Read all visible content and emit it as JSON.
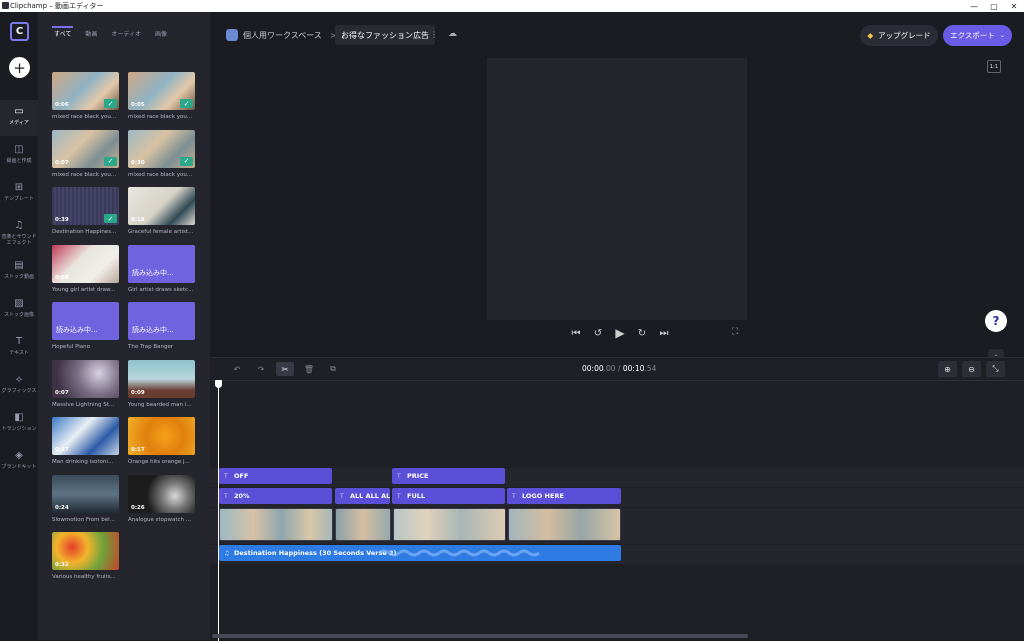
{
  "window": {
    "title": "Clipchamp – 動画エディター",
    "minimize": "—",
    "maximize": "▢",
    "close": "✕"
  },
  "colors": {
    "accent": "#6b5ce7",
    "text_clip": "#5b4fd8",
    "audio_clip": "#2d7be3",
    "check": "#2aa889"
  },
  "rail": {
    "logo": "C",
    "add": "+",
    "items": [
      {
        "icon": "folder-icon",
        "label": "メディア",
        "active": true
      },
      {
        "icon": "camera-icon",
        "label": "録画と作成"
      },
      {
        "icon": "template-icon",
        "label": "テンプレート"
      },
      {
        "icon": "music-icon",
        "label": "音楽とサウンドエフェクト"
      },
      {
        "icon": "film-icon",
        "label": "ストック動画"
      },
      {
        "icon": "image-icon",
        "label": "ストック画像"
      },
      {
        "icon": "text-icon",
        "label": "テキスト"
      },
      {
        "icon": "shapes-icon",
        "label": "グラフィックス"
      },
      {
        "icon": "transition-icon",
        "label": "トランジション"
      },
      {
        "icon": "brand-icon",
        "label": "ブランドキット"
      }
    ]
  },
  "media": {
    "tabs": [
      "すべて",
      "動画",
      "オーディオ",
      "画像"
    ],
    "active_tab": 0,
    "items": [
      {
        "duration": "0:06",
        "caption": "mixed race black you...",
        "checked": true,
        "thumb": "t-outdoor"
      },
      {
        "duration": "0:05",
        "caption": "mixed race black you...",
        "checked": true,
        "thumb": "t-outdoor"
      },
      {
        "duration": "0:07",
        "caption": "mixed race black you...",
        "checked": true,
        "thumb": "t-outdoor2"
      },
      {
        "duration": "0:30",
        "caption": "mixed race black you...",
        "checked": true,
        "thumb": "t-outdoor2"
      },
      {
        "duration": "0:39",
        "caption": "Destination Happines...",
        "checked": true,
        "thumb": "t-audio"
      },
      {
        "duration": "0:18",
        "caption": "Graceful female artist...",
        "checked": false,
        "thumb": "t-artist"
      },
      {
        "duration": "0:08",
        "caption": "Young girl artist draw...",
        "checked": false,
        "thumb": "t-draw"
      },
      {
        "loading": "読み込み中...",
        "caption": "Girl artist draws sketc...",
        "checked": false,
        "thumb": "t-loading"
      },
      {
        "loading": "読み込み中...",
        "caption": "Hopeful Piano",
        "checked": false,
        "thumb": "t-loading"
      },
      {
        "loading": "読み込み中...",
        "caption": "The Trap Banger",
        "checked": false,
        "thumb": "t-loading"
      },
      {
        "duration": "0:07",
        "caption": "Massive Lightning St...",
        "checked": false,
        "thumb": "t-storm"
      },
      {
        "duration": "0:09",
        "caption": "Young bearded man i...",
        "checked": false,
        "thumb": "t-man"
      },
      {
        "duration": "0:27",
        "caption": "Man drinking isotoni...",
        "checked": false,
        "thumb": "t-drink"
      },
      {
        "duration": "0:17",
        "caption": "Orange hits orange j...",
        "checked": false,
        "thumb": "t-orange"
      },
      {
        "duration": "0:24",
        "caption": "Slowmotion From bel...",
        "checked": false,
        "thumb": "t-gym"
      },
      {
        "duration": "0:26",
        "caption": "Analogue stopwatch ...",
        "checked": false,
        "thumb": "t-watch"
      },
      {
        "duration": "0:32",
        "caption": "Various healthy fruits...",
        "checked": false,
        "thumb": "t-fruit"
      }
    ]
  },
  "header": {
    "workspace": "個人用ワークスペース",
    "separator": ">",
    "project_name": "お得なファッション広告",
    "more": "⋮",
    "upgrade": "アップグレード",
    "export": "エクスポート"
  },
  "preview": {
    "aspect_ratio": "1:1",
    "help": "?"
  },
  "timeline": {
    "time_current": "00:00",
    "time_current_ms": ".00",
    "time_slash": " / ",
    "time_total": "00:10",
    "time_total_ms": ".54",
    "text_row1": [
      "OFF",
      "PRICE"
    ],
    "text_row2": [
      "20%",
      "ALL ALL ALL",
      "FULL",
      "LOGO HERE"
    ],
    "audio_clip": "Destination Happiness (30 Seconds Verse 2)"
  }
}
